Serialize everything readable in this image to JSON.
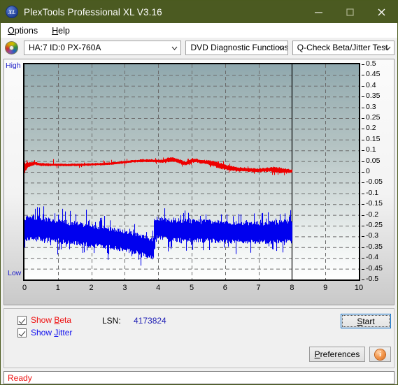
{
  "window": {
    "title": "PlexTools Professional XL V3.16",
    "icon": "XL",
    "minimize": "–",
    "maximize": "□",
    "close": "✕"
  },
  "menu": {
    "items": [
      {
        "label": "Options",
        "accel": "O"
      },
      {
        "label": "Help",
        "accel": "H"
      }
    ]
  },
  "toolbar": {
    "drive": "HA:7 ID:0  PX-760A",
    "functions": "DVD Diagnostic Functions",
    "test": "Q-Check Beta/Jitter Test"
  },
  "controls": {
    "show_beta": "Show Beta",
    "show_jitter": "Show Jitter",
    "show_beta_checked": true,
    "show_jitter_checked": true,
    "lsn_label": "LSN:",
    "lsn_value": "4173824",
    "start": "Start",
    "preferences": "Preferences",
    "info": "i"
  },
  "status": {
    "text": "Ready"
  },
  "chart_data": {
    "type": "line",
    "title": "Q-Check Beta/Jitter Test",
    "xlabel": "",
    "ylabel": "",
    "xlim": [
      0,
      10
    ],
    "ylim": [
      -0.5,
      0.5
    ],
    "grid": true,
    "legend_position": "none",
    "axis_left_labels": [
      "High",
      "Low"
    ],
    "xticks": [
      0,
      1,
      2,
      3,
      4,
      5,
      6,
      7,
      8,
      9,
      10
    ],
    "yticks": [
      0.5,
      0.45,
      0.4,
      0.35,
      0.3,
      0.25,
      0.2,
      0.15,
      0.1,
      0.05,
      0,
      -0.05,
      -0.1,
      -0.15,
      -0.2,
      -0.25,
      -0.3,
      -0.35,
      -0.4,
      -0.45,
      -0.5
    ],
    "ytick_labels": [
      "0.5",
      "0.45",
      "0.4",
      "0.35",
      "0.3",
      "0.25",
      "0.2",
      "0.15",
      "0.1",
      "0.05",
      "0",
      "-0.05",
      "-0.1",
      "-0.15",
      "-0.2",
      "-0.25",
      "-0.3",
      "-0.35",
      "-0.4",
      "-0.45",
      "-0.5"
    ],
    "scan_end_x": 8,
    "colors": {
      "beta": "#ee0000",
      "jitter": "#0000ee",
      "axis_label": "#2020c8"
    },
    "series": [
      {
        "name": "Beta",
        "color": "#ee0000",
        "type": "band",
        "x": [
          0.0,
          0.1,
          0.2,
          0.3,
          0.4,
          0.5,
          0.6,
          0.7,
          0.8,
          0.9,
          1.0,
          1.1,
          1.2,
          1.3,
          1.4,
          1.5,
          1.6,
          1.7,
          1.8,
          1.9,
          2.0,
          2.1,
          2.2,
          2.3,
          2.4,
          2.5,
          2.6,
          2.7,
          2.8,
          2.9,
          3.0,
          3.1,
          3.2,
          3.3,
          3.4,
          3.5,
          3.6,
          3.7,
          3.8,
          3.9,
          4.0,
          4.1,
          4.2,
          4.3,
          4.4,
          4.5,
          4.6,
          4.7,
          4.8,
          4.9,
          5.0,
          5.1,
          5.2,
          5.3,
          5.4,
          5.5,
          5.6,
          5.7,
          5.8,
          5.9,
          6.0,
          6.1,
          6.2,
          6.3,
          6.4,
          6.5,
          6.6,
          6.7,
          6.8,
          6.9,
          7.0,
          7.1,
          7.2,
          7.3,
          7.4,
          7.5,
          7.6,
          7.7,
          7.8,
          7.9,
          8.0
        ],
        "mid": [
          0.02,
          0.034,
          0.036,
          0.04,
          0.037,
          0.034,
          0.034,
          0.033,
          0.033,
          0.033,
          0.033,
          0.032,
          0.032,
          0.032,
          0.033,
          0.033,
          0.033,
          0.033,
          0.034,
          0.034,
          0.035,
          0.035,
          0.036,
          0.036,
          0.037,
          0.038,
          0.039,
          0.041,
          0.042,
          0.044,
          0.046,
          0.048,
          0.049,
          0.05,
          0.051,
          0.052,
          0.052,
          0.052,
          0.052,
          0.051,
          0.05,
          0.049,
          0.052,
          0.056,
          0.057,
          0.055,
          0.05,
          0.044,
          0.039,
          0.044,
          0.052,
          0.054,
          0.05,
          0.047,
          0.046,
          0.044,
          0.04,
          0.035,
          0.03,
          0.026,
          0.022,
          0.019,
          0.016,
          0.014,
          0.012,
          0.011,
          0.01,
          0.009,
          0.008,
          0.007,
          0.007,
          0.008,
          0.01,
          0.011,
          0.011,
          0.01,
          0.008,
          0.006,
          0.005,
          0.004,
          0.004
        ],
        "halfwidth": [
          0.022,
          0.01,
          0.008,
          0.007,
          0.006,
          0.006,
          0.006,
          0.006,
          0.005,
          0.005,
          0.005,
          0.005,
          0.005,
          0.005,
          0.005,
          0.005,
          0.005,
          0.005,
          0.005,
          0.005,
          0.005,
          0.005,
          0.005,
          0.005,
          0.005,
          0.005,
          0.005,
          0.005,
          0.005,
          0.005,
          0.005,
          0.005,
          0.005,
          0.005,
          0.005,
          0.006,
          0.006,
          0.006,
          0.006,
          0.006,
          0.006,
          0.006,
          0.008,
          0.01,
          0.009,
          0.008,
          0.009,
          0.009,
          0.008,
          0.01,
          0.009,
          0.008,
          0.008,
          0.008,
          0.008,
          0.009,
          0.01,
          0.011,
          0.012,
          0.012,
          0.011,
          0.01,
          0.01,
          0.009,
          0.009,
          0.008,
          0.008,
          0.008,
          0.008,
          0.008,
          0.008,
          0.008,
          0.008,
          0.009,
          0.011,
          0.013,
          0.012,
          0.01,
          0.009,
          0.008,
          0.007
        ],
        "note": "Beta value ~0.00 to 0.06, averaging about 0.03-0.05"
      },
      {
        "name": "Jitter",
        "color": "#0000ee",
        "type": "band",
        "x": [
          0.0,
          0.1,
          0.2,
          0.3,
          0.4,
          0.5,
          0.6,
          0.7,
          0.8,
          0.9,
          1.0,
          1.1,
          1.2,
          1.3,
          1.4,
          1.5,
          1.6,
          1.7,
          1.8,
          1.9,
          2.0,
          2.1,
          2.2,
          2.3,
          2.4,
          2.5,
          2.6,
          2.7,
          2.8,
          2.9,
          3.0,
          3.1,
          3.2,
          3.3,
          3.4,
          3.5,
          3.6,
          3.7,
          3.8,
          3.85,
          3.9,
          4.0,
          4.1,
          4.2,
          4.3,
          4.4,
          4.5,
          4.6,
          4.7,
          4.8,
          4.9,
          5.0,
          5.1,
          5.2,
          5.3,
          5.4,
          5.5,
          5.6,
          5.7,
          5.8,
          5.9,
          6.0,
          6.1,
          6.2,
          6.3,
          6.4,
          6.5,
          6.6,
          6.7,
          6.8,
          6.9,
          7.0,
          7.1,
          7.2,
          7.3,
          7.4,
          7.5,
          7.6,
          7.7,
          7.8,
          7.9,
          8.0
        ],
        "mid": [
          -0.268,
          -0.262,
          -0.258,
          -0.262,
          -0.262,
          -0.265,
          -0.268,
          -0.27,
          -0.272,
          -0.273,
          -0.274,
          -0.277,
          -0.28,
          -0.282,
          -0.284,
          -0.286,
          -0.288,
          -0.29,
          -0.292,
          -0.294,
          -0.296,
          -0.298,
          -0.3,
          -0.302,
          -0.304,
          -0.306,
          -0.308,
          -0.311,
          -0.314,
          -0.317,
          -0.32,
          -0.324,
          -0.328,
          -0.332,
          -0.336,
          -0.34,
          -0.345,
          -0.35,
          -0.356,
          -0.36,
          -0.262,
          -0.262,
          -0.264,
          -0.266,
          -0.268,
          -0.269,
          -0.27,
          -0.271,
          -0.272,
          -0.272,
          -0.273,
          -0.274,
          -0.274,
          -0.275,
          -0.275,
          -0.276,
          -0.276,
          -0.277,
          -0.277,
          -0.278,
          -0.278,
          -0.279,
          -0.279,
          -0.28,
          -0.28,
          -0.28,
          -0.281,
          -0.281,
          -0.281,
          -0.282,
          -0.282,
          -0.282,
          -0.282,
          -0.282,
          -0.281,
          -0.281,
          -0.28,
          -0.279,
          -0.278,
          -0.277,
          -0.276,
          -0.274
        ],
        "halfwidth": [
          0.048,
          0.05,
          0.052,
          0.05,
          0.048,
          0.048,
          0.048,
          0.048,
          0.047,
          0.047,
          0.046,
          0.046,
          0.046,
          0.045,
          0.045,
          0.045,
          0.045,
          0.044,
          0.044,
          0.044,
          0.044,
          0.044,
          0.044,
          0.043,
          0.043,
          0.043,
          0.043,
          0.043,
          0.043,
          0.042,
          0.042,
          0.042,
          0.042,
          0.042,
          0.041,
          0.041,
          0.041,
          0.041,
          0.041,
          0.04,
          0.045,
          0.045,
          0.045,
          0.045,
          0.045,
          0.045,
          0.045,
          0.045,
          0.045,
          0.045,
          0.044,
          0.044,
          0.044,
          0.044,
          0.044,
          0.044,
          0.044,
          0.044,
          0.044,
          0.044,
          0.044,
          0.044,
          0.044,
          0.044,
          0.044,
          0.044,
          0.044,
          0.044,
          0.044,
          0.044,
          0.044,
          0.044,
          0.044,
          0.044,
          0.045,
          0.045,
          0.045,
          0.045,
          0.046,
          0.046,
          0.047,
          0.048
        ],
        "note": "Jitter band approx -0.22 to -0.40, drifting down until 3.9 then resetting"
      }
    ]
  }
}
